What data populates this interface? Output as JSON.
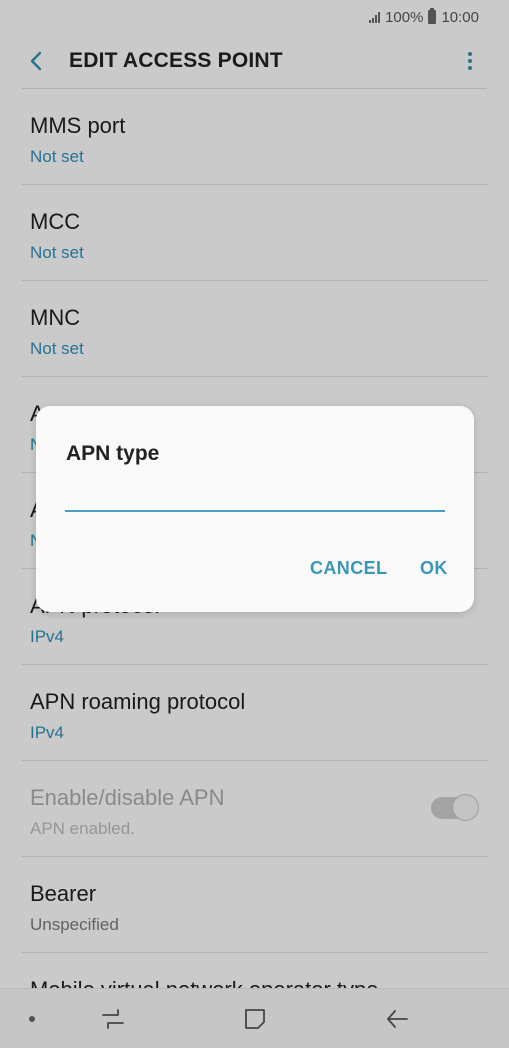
{
  "status_bar": {
    "battery": "100%",
    "time": "10:00"
  },
  "header": {
    "title": "EDIT ACCESS POINT"
  },
  "list": [
    {
      "title": "MMS port",
      "value": "Not set"
    },
    {
      "title": "MCC",
      "value": "Not set"
    },
    {
      "title": "MNC",
      "value": "Not set"
    },
    {
      "title": "A",
      "value": "N"
    },
    {
      "title": "A",
      "value": "N"
    },
    {
      "title": "APN protocol",
      "value": "IPv4"
    },
    {
      "title": "APN roaming protocol",
      "value": "IPv4"
    },
    {
      "title": "Enable/disable APN",
      "value": "APN enabled.",
      "toggle_on": true
    },
    {
      "title": "Bearer",
      "value": "Unspecified"
    },
    {
      "title": "Mobile virtual network operator type",
      "value": ""
    }
  ],
  "dialog": {
    "title": "APN type",
    "input_value": "",
    "cancel_label": "CANCEL",
    "ok_label": "OK"
  },
  "icons": {
    "back": "back-arrow-icon",
    "more": "more-vert-icon",
    "recent": "recent-apps-icon",
    "home": "home-icon",
    "nav_back": "nav-back-icon"
  },
  "colors": {
    "accent": "#2e8bb5",
    "toggle_off": "#c8c8c8"
  }
}
